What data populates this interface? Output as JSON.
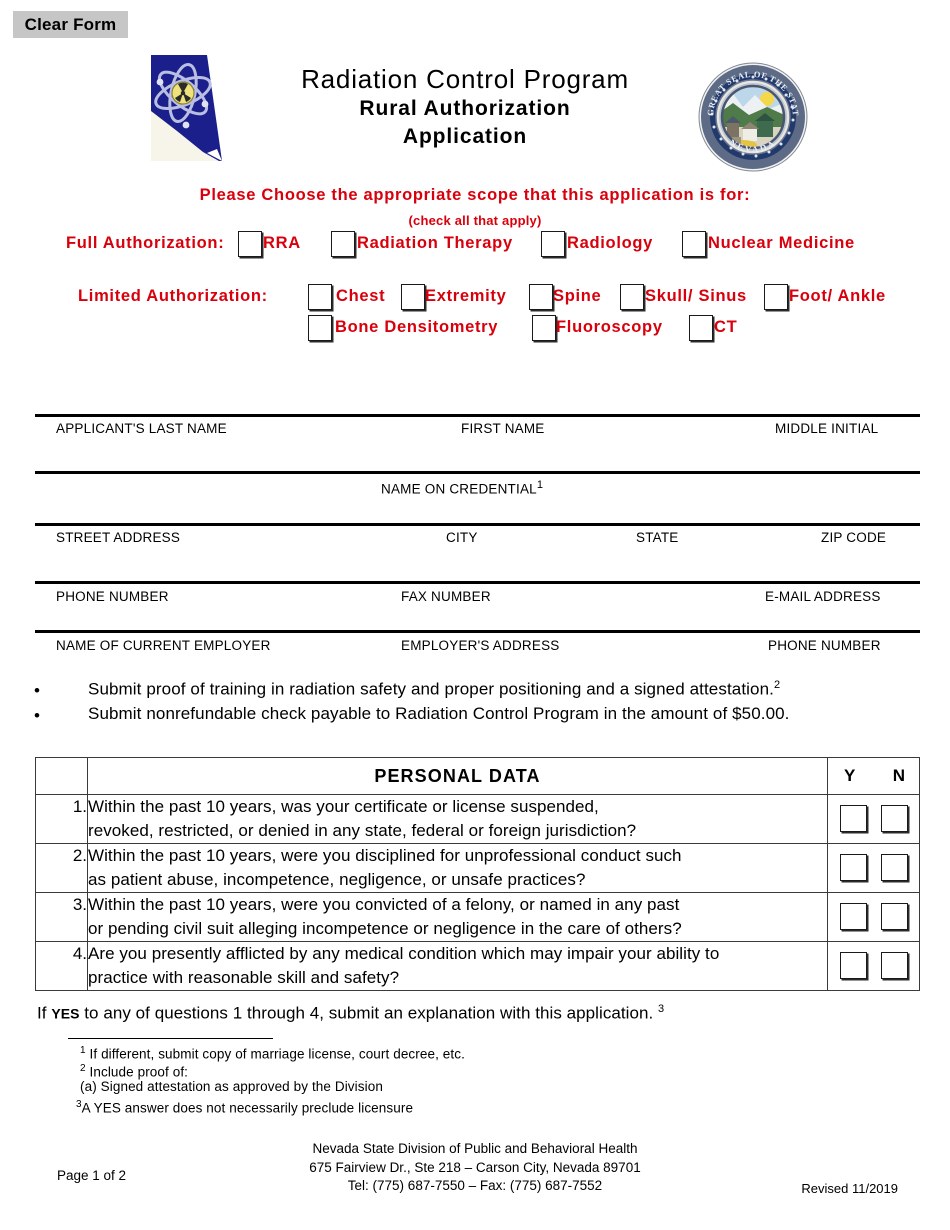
{
  "toolbar": {
    "clear_form_label": "Clear Form"
  },
  "header": {
    "title_line1": "Radiation Control Program",
    "title_line2": "Rural Authorization",
    "title_line3": "Application",
    "logo_name": "nevada-atom-logo",
    "seal_name": "nevada-state-seal",
    "seal_text_outer": "THE GREAT SEAL OF THE STATE OF",
    "seal_text_bottom": "NEVADA"
  },
  "scope": {
    "instruction": "Please Choose the appropriate scope that this application is for:",
    "sub_instruction": "(check all that apply)",
    "accent_color": "#d8000c",
    "full_authorization_label": "Full Authorization:",
    "full_options": [
      {
        "label": "RRA",
        "checked": false
      },
      {
        "label": "Radiation Therapy",
        "checked": false
      },
      {
        "label": "Radiology",
        "checked": false
      },
      {
        "label": "Nuclear Medicine",
        "checked": false
      }
    ],
    "limited_authorization_label": "Limited Authorization:",
    "limited_options_row1": [
      {
        "label": "Chest",
        "checked": false
      },
      {
        "label": "Extremity",
        "checked": false
      },
      {
        "label": "Spine",
        "checked": false
      },
      {
        "label": "Skull/ Sinus",
        "checked": false
      },
      {
        "label": "Foot/ Ankle",
        "checked": false
      }
    ],
    "limited_options_row2": [
      {
        "label": "Bone Densitometry",
        "checked": false
      },
      {
        "label": "Fluoroscopy",
        "checked": false
      },
      {
        "label": "CT",
        "checked": false
      }
    ]
  },
  "fields": {
    "row1": [
      {
        "label": "APPLICANT'S LAST NAME",
        "value": ""
      },
      {
        "label": "FIRST NAME",
        "value": ""
      },
      {
        "label": "MIDDLE INITIAL",
        "value": ""
      }
    ],
    "row2": [
      {
        "label": "NAME ON CREDENTIAL",
        "footnote": "1",
        "value": ""
      }
    ],
    "row3": [
      {
        "label": "STREET ADDRESS",
        "value": ""
      },
      {
        "label": "CITY",
        "value": ""
      },
      {
        "label": "STATE",
        "value": ""
      },
      {
        "label": "ZIP CODE",
        "value": ""
      }
    ],
    "row4": [
      {
        "label": "PHONE NUMBER",
        "value": ""
      },
      {
        "label": "FAX NUMBER",
        "value": ""
      },
      {
        "label": "E-MAIL ADDRESS",
        "value": ""
      }
    ],
    "row5": [
      {
        "label": "NAME OF CURRENT EMPLOYER",
        "value": ""
      },
      {
        "label": "EMPLOYER'S ADDRESS",
        "value": ""
      },
      {
        "label": "PHONE NUMBER",
        "value": ""
      }
    ]
  },
  "requirements": {
    "bullet_char": "•",
    "items": [
      {
        "text": "Submit proof of training in radiation safety and proper positioning and a signed attestation.",
        "footnote": "2"
      },
      {
        "text": "Submit nonrefundable check payable to Radiation Control Program in the amount of $50.00.",
        "footnote": ""
      }
    ]
  },
  "personal_data": {
    "header_title": "PERSONAL DATA",
    "header_yes": "Y",
    "header_no": "N",
    "rows": [
      {
        "number": "1.",
        "line1": "Within the past 10 years, was your certificate or license suspended,",
        "line2": "revoked, restricted, or denied in any state, federal or foreign jurisdiction?",
        "yes_checked": false,
        "no_checked": false
      },
      {
        "number": "2.",
        "line1": "Within the past 10 years, were you disciplined for unprofessional conduct such",
        "line2": "as patient abuse, incompetence, negligence, or unsafe practices?",
        "yes_checked": false,
        "no_checked": false
      },
      {
        "number": "3.",
        "line1": "Within the past 10 years, were you convicted of a felony, or named in any past",
        "line2": "or pending civil suit alleging incompetence or negligence in the care of others?",
        "yes_checked": false,
        "no_checked": false
      },
      {
        "number": "4.",
        "line1": "Are you presently afflicted by any medical condition which may impair your ability to",
        "line2": "practice with reasonable skill and safety?",
        "yes_checked": false,
        "no_checked": false
      }
    ]
  },
  "if_yes": {
    "prefix": "If ",
    "emphasis": "YES",
    "suffix": " to any of questions 1 through 4, submit an explanation with this application. ",
    "footnote": "3"
  },
  "footnotes": [
    {
      "marker": "1",
      "text": " If different, submit copy of marriage license, court decree, etc."
    },
    {
      "marker": "2",
      "text": " Include proof of:"
    },
    {
      "marker": "",
      "text": "  (a) Signed attestation as approved by the Division"
    },
    {
      "marker": "3",
      "text": "A YES answer does not necessarily preclude licensure"
    }
  ],
  "footer": {
    "page": "Page 1 of 2",
    "org_line1": "Nevada State Division of Public and Behavioral Health",
    "org_line2": "675 Fairview Dr., Ste 218 – Carson City, Nevada 89701",
    "org_line3": "Tel: (775) 687-7550 – Fax: (775) 687-7552",
    "revised": "Revised 11/2019"
  }
}
